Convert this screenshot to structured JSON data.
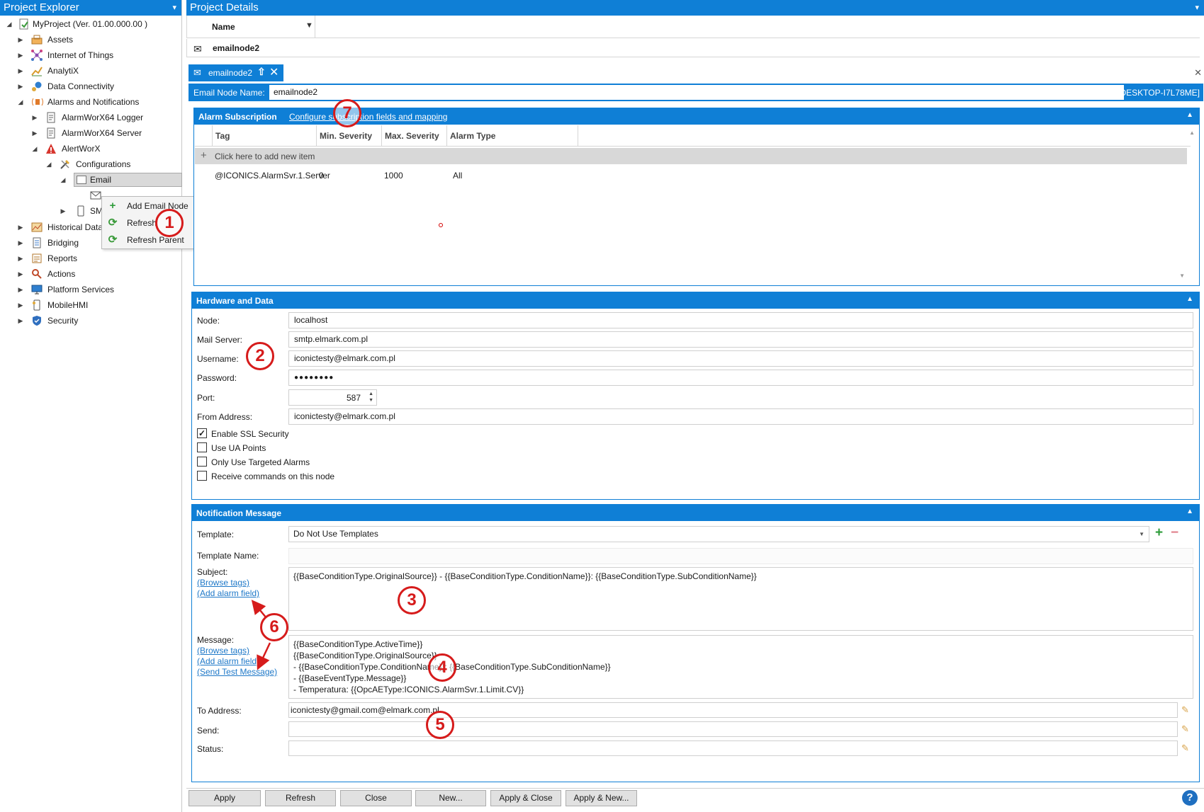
{
  "explorer": {
    "title": "Project Explorer",
    "pin": "▾",
    "project": "MyProject (Ver. 01.00.000.00 )",
    "items": [
      {
        "label": "Assets",
        "icon": "assets-icon"
      },
      {
        "label": "Internet of Things",
        "icon": "iot-icon"
      },
      {
        "label": "AnalytiX",
        "icon": "analytix-icon"
      },
      {
        "label": "Data Connectivity",
        "icon": "data-connectivity-icon"
      },
      {
        "label": "Alarms and Notifications",
        "icon": "alarms-icon"
      },
      {
        "label": "AlarmWorX64 Logger",
        "icon": "logger-icon"
      },
      {
        "label": "AlarmWorX64 Server",
        "icon": "server-icon"
      },
      {
        "label": "AlertWorX",
        "icon": "alert-icon"
      },
      {
        "label": "Configurations",
        "icon": "configurations-icon"
      },
      {
        "label": "Email",
        "icon": "email-folder-icon"
      },
      {
        "label": "SM",
        "icon": "sms-icon"
      },
      {
        "label": "Historical Data",
        "icon": "historical-icon"
      },
      {
        "label": "Bridging",
        "icon": "bridging-icon"
      },
      {
        "label": "Reports",
        "icon": "reports-icon"
      },
      {
        "label": "Actions",
        "icon": "actions-icon"
      },
      {
        "label": "Platform Services",
        "icon": "platform-icon"
      },
      {
        "label": "MobileHMI",
        "icon": "mobilehmi-icon"
      },
      {
        "label": "Security",
        "icon": "security-icon"
      }
    ],
    "context_menu": [
      {
        "label": "Add Email Node",
        "icon": "+"
      },
      {
        "label": "Refresh",
        "icon": "⟳"
      },
      {
        "label": "Refresh Parent",
        "icon": "⟳"
      }
    ]
  },
  "details": {
    "title": "Project Details",
    "grid_header": "Name",
    "grid_row": "emailnode2",
    "tab_label": "emailnode2",
    "node_name_label": "Email Node Name:",
    "node_name_value": "emailnode2",
    "host": "[DESKTOP-I7L78ME]",
    "subscription": {
      "title": "Alarm Subscription",
      "config_link": "Configure subscription fields and mapping",
      "columns": [
        "Tag",
        "Min. Severity",
        "Max. Severity",
        "Alarm Type"
      ],
      "add_row": "Click here to add new item",
      "rows": [
        {
          "tag": "@ICONICS.AlarmSvr.1.Server",
          "min": "0",
          "max": "1000",
          "type": "All"
        }
      ]
    },
    "hardware": {
      "title": "Hardware and Data",
      "node_label": "Node:",
      "node": "localhost",
      "mail_label": "Mail Server:",
      "mail": "smtp.elmark.com.pl",
      "user_label": "Username:",
      "user": "iconictesty@elmark.com.pl",
      "pass_label": "Password:",
      "pass": "●●●●●●●●",
      "port_label": "Port:",
      "port": "587",
      "from_label": "From Address:",
      "from": "iconictesty@elmark.com.pl",
      "checks": [
        {
          "label": "Enable SSL Security",
          "checked": true,
          "mark": "✓"
        },
        {
          "label": "Use UA Points",
          "checked": false,
          "mark": ""
        },
        {
          "label": "Only Use Targeted Alarms",
          "checked": false,
          "mark": ""
        },
        {
          "label": "Receive commands on this node",
          "checked": false,
          "mark": ""
        }
      ]
    },
    "notification": {
      "title": "Notification Message",
      "template_label": "Template:",
      "template": "Do Not Use Templates",
      "template_name_label": "Template Name:",
      "subject_label": "Subject:",
      "subject": "{{BaseConditionType.OriginalSource}} - {{BaseConditionType.ConditionName}}: {{BaseConditionType.SubConditionName}}",
      "browse_tags": "(Browse tags)",
      "add_alarm_field": "(Add alarm field)",
      "message_label": "Message:",
      "send_test": "(Send Test Message)",
      "message": "{{BaseConditionType.ActiveTime}}\n{{BaseConditionType.OriginalSource}}\n- {{BaseConditionType.ConditionName}}: {{BaseConditionType.SubConditionName}}\n- {{BaseEventType.Message}}\n- Temperatura: {{OpcAEType:ICONICS.AlarmSvr.1.Limit.CV}}",
      "to_label": "To Address:",
      "to": "iconictesty@gmail.com@elmark.com.pl",
      "send_label": "Send:",
      "status_label": "Status:"
    },
    "buttons": [
      "Apply",
      "Refresh",
      "Close",
      "New...",
      "Apply & Close",
      "Apply & New..."
    ],
    "help": "?"
  },
  "annotations": [
    "1",
    "2",
    "3",
    "4",
    "5",
    "6",
    "7"
  ],
  "colors": {
    "accent": "#0f7fd6",
    "annotation": "#d61b1b"
  }
}
